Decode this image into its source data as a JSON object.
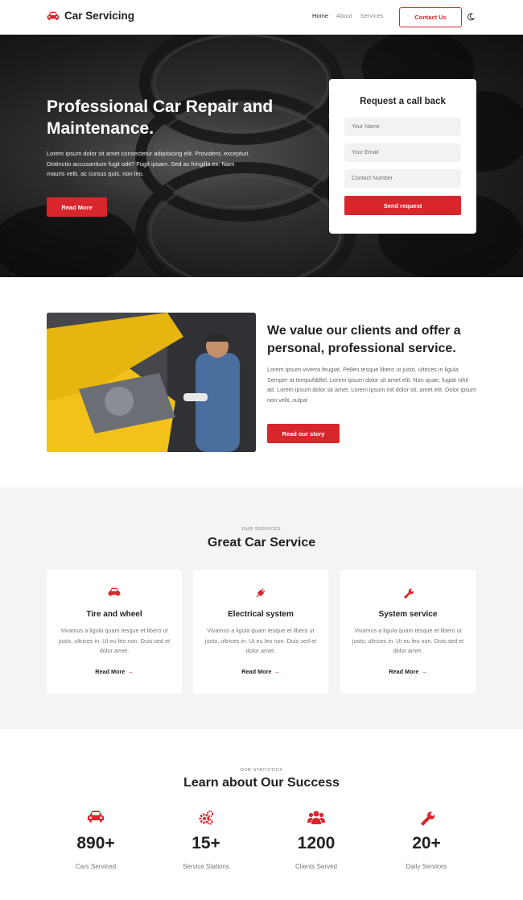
{
  "header": {
    "brand": "Car Servicing",
    "nav": [
      "Home",
      "About",
      "Services"
    ],
    "contact_label": "Contact Us"
  },
  "hero": {
    "title": "Professional Car Repair and Maintenance.",
    "text": "Lorem ipsum dolor sit amet consectetur adipisicing elit. Provident, excepturi. Distinctio accusantium fugit odit? Fugit ipsam. Sed ac fringilla ex. Nam mauris velit, ac cursus quis, non leo.",
    "button_label": "Read More"
  },
  "callback": {
    "title": "Request a call back",
    "name_placeholder": "Your Name",
    "email_placeholder": "Your Email",
    "phone_placeholder": "Contact Number",
    "button_label": "Send request"
  },
  "about": {
    "title": "We value our clients and offer a personal, professional service.",
    "text": "Lorem ipsum viverra feugiat. Pellen tesque libero ut justo, ultrices in ligula. Semper at tempufddfel. Lorem ipsum dolor sit amet elit. Non quae, fugiat nihil ad. Lorem ipsum dolor sit amet. Lorem ipsum init dolor sit, amet elit. Dolor ipsum non velit, culpa!",
    "button_label": "Read our story"
  },
  "services": {
    "eyebrow": "OUR SERVICES",
    "title": "Great Car Service",
    "cards": [
      {
        "icon": "car-icon",
        "title": "Tire and wheel",
        "text": "Vivamus a ligula quam tesque et libero ut justo, ultrices in. Ut eu leo non. Duis sed et dolor amet.",
        "link": "Read More"
      },
      {
        "icon": "plug-icon",
        "title": "Electrical system",
        "text": "Vivamus a ligula quam tesque et libero ut justo, ultrices in. Ut eu leo non. Duis sed et dolor amet.",
        "link": "Read More"
      },
      {
        "icon": "wrench-icon",
        "title": "System service",
        "text": "Vivamus a ligula quam tesque et libero ut justo, ultrices in. Ut eu leo non. Duis sed et dolor amet.",
        "link": "Read More"
      }
    ]
  },
  "stats": {
    "eyebrow": "OUR STATISTICS",
    "title": "Learn about Our Success",
    "items": [
      {
        "icon": "car-icon",
        "value": "890+",
        "label": "Cars Serviced"
      },
      {
        "icon": "gears-icon",
        "value": "15+",
        "label": "Service Stations"
      },
      {
        "icon": "users-icon",
        "value": "1200",
        "label": "Clients Served"
      },
      {
        "icon": "wrench-icon",
        "value": "20+",
        "label": "Daily Services"
      }
    ]
  },
  "colors": {
    "accent": "#d9262c",
    "text": "#222222",
    "muted": "#777777",
    "section_bg": "#f4f4f4"
  }
}
